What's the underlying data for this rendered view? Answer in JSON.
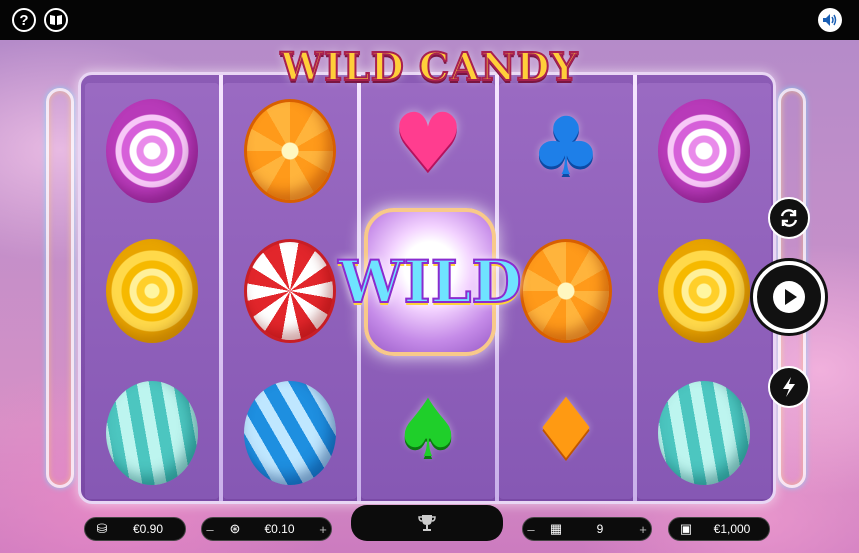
{
  "topbar": {
    "help_icon": "?",
    "paytable_icon": "book-icon",
    "sound_icon": "speaker-icon"
  },
  "game": {
    "title": "WILD CANDY",
    "wild_label": "WILD"
  },
  "reels": [
    [
      "swirl-candy",
      "lemon-candy",
      "mint-candy"
    ],
    [
      "orange-candy",
      "peppermint-candy",
      "blue-candy"
    ],
    [
      "heart",
      "wild",
      "spade"
    ],
    [
      "club",
      "orange-candy",
      "diamond"
    ],
    [
      "swirl-candy",
      "lemon-candy",
      "mint-candy"
    ]
  ],
  "controls": {
    "autoplay_icon": "refresh-icon",
    "spin_icon": "play-icon",
    "turbo_icon": "lightning-icon"
  },
  "bottom": {
    "total_bet": "€0.90",
    "coin_value": "€0.10",
    "minus": "–",
    "plus": "+",
    "lines": "9",
    "balance": "€1,000",
    "win_icon": "trophy-icon"
  },
  "colors": {
    "background": "#c48fc9",
    "reel_bg": "#8b5bb5",
    "title_fill": "#ffcf3a",
    "title_stroke": "#a8204f"
  }
}
